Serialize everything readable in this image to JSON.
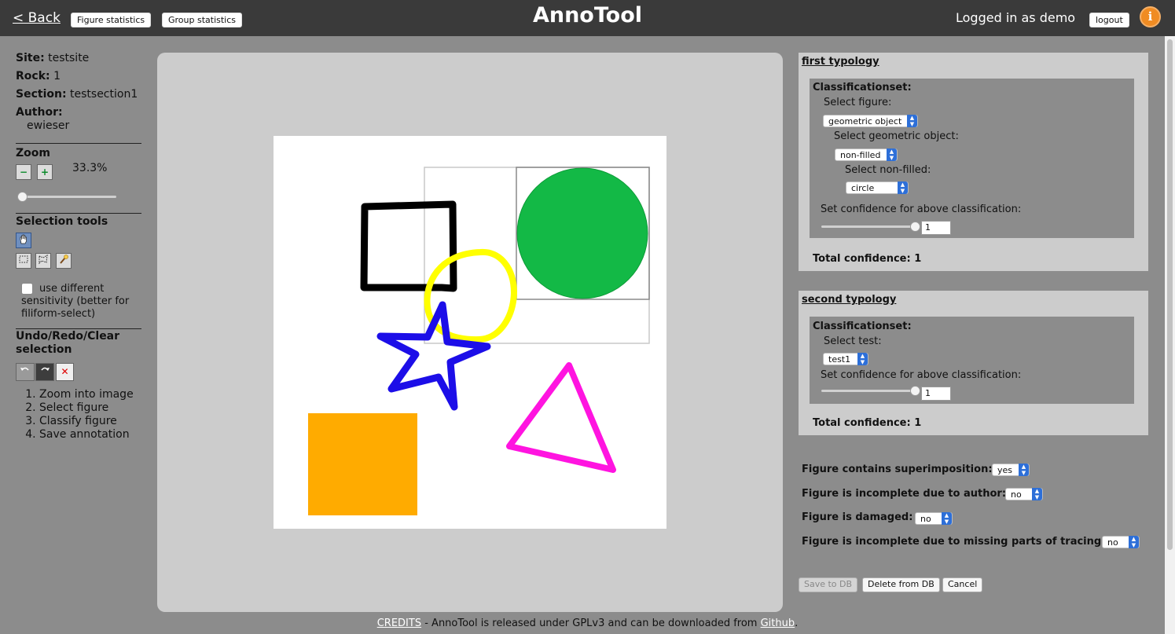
{
  "header": {
    "back_label": "< Back",
    "figure_stats_label": "Figure statistics",
    "group_stats_label": "Group statistics",
    "app_title": "AnnoTool",
    "logged_in_text": "Logged in as demo",
    "logout_label": "logout",
    "info_glyph": "i"
  },
  "meta": {
    "site_label": "Site:",
    "site_value": "testsite",
    "rock_label": "Rock:",
    "rock_value": "1",
    "section_label": "Section:",
    "section_value": "testsection1",
    "author_label": "Author:",
    "author_value": "ewieser"
  },
  "zoom": {
    "heading": "Zoom",
    "minus": "−",
    "plus": "+",
    "value_text": "33.3%",
    "slider_fraction": 0.0
  },
  "selection_tools": {
    "heading": "Selection tools",
    "tools": [
      "pan-hand-icon",
      "rectangle-select-icon",
      "lasso-select-icon",
      "magic-wand-icon"
    ],
    "checkbox_label": "use different sensitivity (better for filiform-select)",
    "checkbox_checked": false
  },
  "undo": {
    "heading": "Undo/Redo/Clear selection",
    "clear_glyph": "✕"
  },
  "steps": [
    "Zoom into image",
    "Select figure",
    "Classify figure",
    "Save annotation"
  ],
  "typologies": [
    {
      "title": "first typology",
      "set_label": "Classificationset:",
      "select_figure_label": "Select figure:",
      "select_figure_value": "geometric object",
      "select_geo_label": "Select geometric object:",
      "select_geo_value": "non-filled",
      "select_nonfilled_label": "Select non-filled:",
      "select_nonfilled_value": "circle",
      "confidence_label": "Set confidence for above classification:",
      "confidence_value": "1",
      "total_label": "Total confidence: 1"
    },
    {
      "title": "second typology",
      "set_label": "Classificationset:",
      "select_test_label": "Select test:",
      "select_test_value": "test1",
      "confidence_label": "Set confidence for above classification:",
      "confidence_value": "1",
      "total_label": "Total confidence: 1"
    }
  ],
  "questions": [
    {
      "label": "Figure contains superimposition:",
      "value": "yes"
    },
    {
      "label": "Figure is incomplete due to author:",
      "value": "no"
    },
    {
      "label": "Figure is damaged:",
      "value": "no"
    },
    {
      "label": "Figure is incomplete due to missing parts of tracing:",
      "value": "no"
    }
  ],
  "actions": {
    "save_label": "Save to DB",
    "delete_label": "Delete from DB",
    "cancel_label": "Cancel"
  },
  "footer": {
    "credits_link": "CREDITS",
    "middle_text": " - AnnoTool is released under GPLv3 and can be downloaded from ",
    "github_link": "Github",
    "end_text": "."
  },
  "colors": {
    "topbar": "#3a3a3a",
    "page_bg": "#8c8c8c",
    "panel_bg": "#cccccc",
    "select_arrow": "#2d6fd8",
    "info_orange": "#f08c23",
    "shape_green": "#13b946",
    "shape_orange": "#ffab00",
    "shape_yellow": "#ffff00",
    "shape_blue": "#1c0ee8",
    "shape_magenta": "#ff14e0"
  }
}
